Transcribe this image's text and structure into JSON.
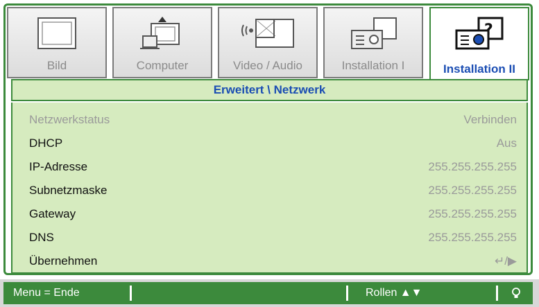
{
  "tabs": [
    {
      "label": "Bild",
      "icon": "picture-icon"
    },
    {
      "label": "Computer",
      "icon": "computer-icon"
    },
    {
      "label": "Video / Audio",
      "icon": "video-audio-icon"
    },
    {
      "label": "Installation I",
      "icon": "projector-icon"
    },
    {
      "label": "Installation II",
      "icon": "projector-settings-icon",
      "active": true
    }
  ],
  "section_title": "Erweitert \\ Netzwerk",
  "settings": [
    {
      "label": "Netzwerkstatus",
      "value": "Verbinden"
    },
    {
      "label": "DHCP",
      "value": "Aus"
    },
    {
      "label": "IP-Adresse",
      "value": "255.255.255.255"
    },
    {
      "label": "Subnetzmaske",
      "value": "255.255.255.255"
    },
    {
      "label": "Gateway",
      "value": "255.255.255.255"
    },
    {
      "label": "DNS",
      "value": "255.255.255.255"
    },
    {
      "label": "Übernehmen",
      "value": "↵/▶"
    }
  ],
  "footer": {
    "menu_label": "Menu = Ende",
    "scroll_label": "Rollen ▲▼",
    "bulb_icon": "bulb-icon"
  },
  "colors": {
    "accent": "#3c8a3c",
    "panel": "#d6ebbf",
    "active_text": "#1a4db3"
  }
}
